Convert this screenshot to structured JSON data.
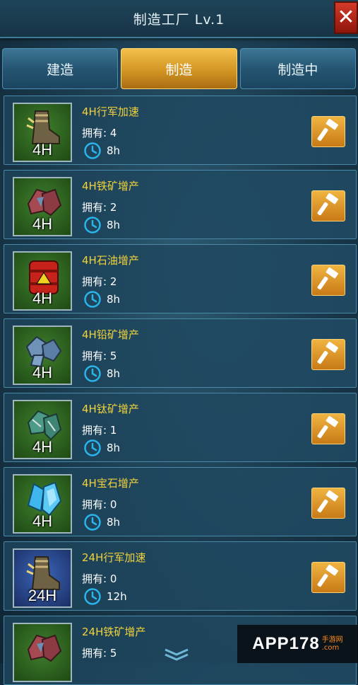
{
  "window": {
    "title": "制造工厂 Lv.1"
  },
  "tabs": [
    {
      "label": "建造",
      "active": false
    },
    {
      "label": "制造",
      "active": true
    },
    {
      "label": "制造中",
      "active": false
    }
  ],
  "items": [
    {
      "name": "4H行军加速",
      "own": "拥有: 4",
      "time": "8h",
      "tag": "4H",
      "icon": "boot-speed-icon",
      "arrow": false
    },
    {
      "name": "4H铁矿增产",
      "own": "拥有: 2",
      "time": "8h",
      "tag": "4H",
      "icon": "iron-ore-icon",
      "arrow": true
    },
    {
      "name": "4H石油增产",
      "own": "拥有: 2",
      "time": "8h",
      "tag": "4H",
      "icon": "oil-barrel-icon",
      "arrow": true
    },
    {
      "name": "4H铅矿增产",
      "own": "拥有: 5",
      "time": "8h",
      "tag": "4H",
      "icon": "lead-ore-icon",
      "arrow": true
    },
    {
      "name": "4H钛矿增产",
      "own": "拥有: 1",
      "time": "8h",
      "tag": "4H",
      "icon": "titanium-ore-icon",
      "arrow": true
    },
    {
      "name": "4H宝石增产",
      "own": "拥有: 0",
      "time": "8h",
      "tag": "4H",
      "icon": "gem-icon",
      "arrow": true
    },
    {
      "name": "24H行军加速",
      "own": "拥有: 0",
      "time": "12h",
      "tag": "24H",
      "icon": "boot-speed-icon",
      "arrow": false
    },
    {
      "name": "24H铁矿增产",
      "own": "拥有: 5",
      "time": "",
      "tag": "",
      "icon": "iron-ore-icon",
      "arrow": false
    }
  ],
  "watermark": {
    "text": "APP178",
    "sub_top": "手游网",
    "sub_bottom": ".com"
  },
  "colors": {
    "accent_gold": "#f1d23a",
    "active_tab": "#d29624",
    "close": "#c2281a"
  }
}
